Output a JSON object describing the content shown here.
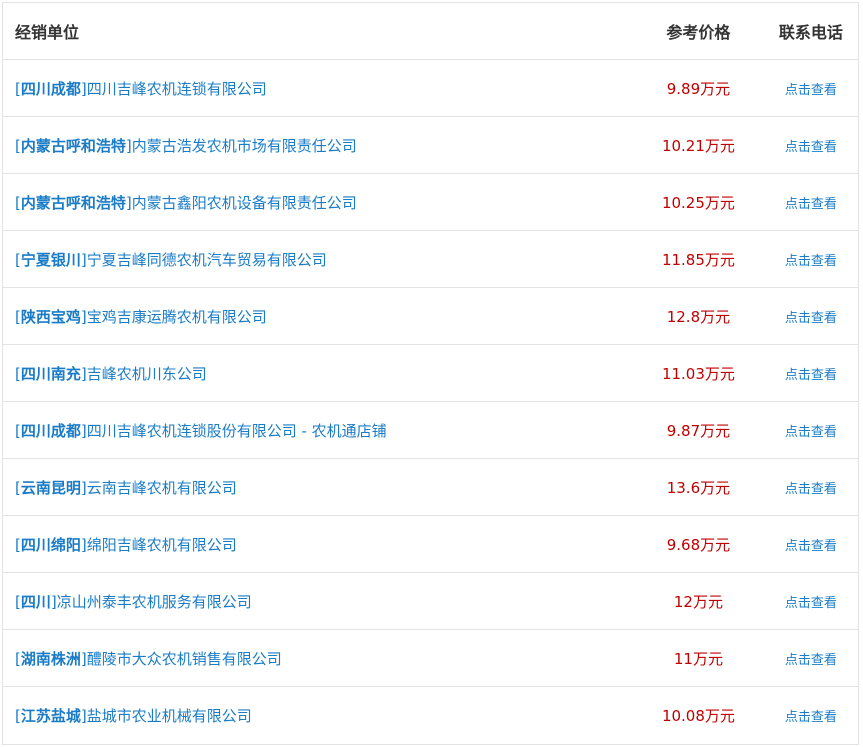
{
  "headers": {
    "dealer": "经销单位",
    "price": "参考价格",
    "contact": "联系电话"
  },
  "rows": [
    {
      "region": "四川成都",
      "dealer": "四川吉峰农机连锁有限公司",
      "price": "9.89万元",
      "contact": "点击查看"
    },
    {
      "region": "内蒙古呼和浩特",
      "dealer": "内蒙古浩发农机市场有限责任公司",
      "price": "10.21万元",
      "contact": "点击查看"
    },
    {
      "region": "内蒙古呼和浩特",
      "dealer": "内蒙古鑫阳农机设备有限责任公司",
      "price": "10.25万元",
      "contact": "点击查看"
    },
    {
      "region": "宁夏银川",
      "dealer": "宁夏吉峰同德农机汽车贸易有限公司",
      "price": "11.85万元",
      "contact": "点击查看"
    },
    {
      "region": "陕西宝鸡",
      "dealer": "宝鸡吉康运腾农机有限公司",
      "price": "12.8万元",
      "contact": "点击查看"
    },
    {
      "region": "四川南充",
      "dealer": "吉峰农机川东公司",
      "price": "11.03万元",
      "contact": "点击查看"
    },
    {
      "region": "四川成都",
      "dealer": "四川吉峰农机连锁股份有限公司 - 农机通店铺",
      "price": "9.87万元",
      "contact": "点击查看"
    },
    {
      "region": "云南昆明",
      "dealer": "云南吉峰农机有限公司",
      "price": "13.6万元",
      "contact": "点击查看"
    },
    {
      "region": "四川绵阳",
      "dealer": "绵阳吉峰农机有限公司",
      "price": "9.68万元",
      "contact": "点击查看"
    },
    {
      "region": "四川",
      "dealer": "凉山州泰丰农机服务有限公司",
      "price": "12万元",
      "contact": "点击查看"
    },
    {
      "region": "湖南株洲",
      "dealer": "醴陵市大众农机销售有限公司",
      "price": "11万元",
      "contact": "点击查看"
    },
    {
      "region": "江苏盐城",
      "dealer": "盐城市农业机械有限公司",
      "price": "10.08万元",
      "contact": "点击查看"
    }
  ]
}
